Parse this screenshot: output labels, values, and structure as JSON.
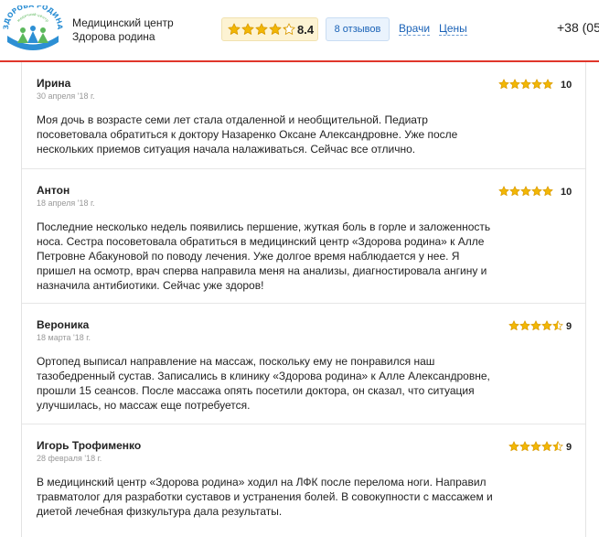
{
  "header": {
    "logo_text": "ЗДОРОВА РОДИНА",
    "logo_subtext": "медичний центр",
    "center_name": "Медицинский центр Здорова родина",
    "rating": {
      "score": "8.4",
      "stars_value": 4.2,
      "stars_max": 5
    },
    "reviews_button": "8 отзывов",
    "nav": {
      "doctors": "Врачи",
      "prices": "Цены"
    },
    "phone": "+38 (05"
  },
  "colors": {
    "accent_red": "#e0362b",
    "star_gold": "#f2b705",
    "link_blue": "#1a62b7",
    "logo_blue": "#2d8fd4",
    "logo_green": "#5cb85c"
  },
  "reviews": [
    {
      "name": "Ирина",
      "date": "30 апреля '18 г.",
      "score": "10",
      "stars_value": 5,
      "text": "Моя дочь в возрасте семи лет стала отдаленной и необщительной. Педиатр посоветовала обратиться к доктору Назаренко Оксане Александровне. Уже после нескольких приемов ситуация начала налаживаться. Сейчас все отлично."
    },
    {
      "name": "Антон",
      "date": "18 апреля '18 г.",
      "score": "10",
      "stars_value": 5,
      "text": "Последние несколько недель появились першение, жуткая боль в горле и заложенность носа. Сестра посоветовала обратиться в медицинский центр «Здорова родина» к Алле Петровне Абакуновой по поводу лечения. Уже долгое время наблюдается у нее. Я пришел на осмотр, врач сперва направила меня на анализы, диагностировала ангину и назначила антибиотики. Сейчас уже здоров!"
    },
    {
      "name": "Вероника",
      "date": "18 марта '18 г.",
      "score": "9",
      "stars_value": 4.5,
      "text": "Ортопед выписал направление на массаж, поскольку ему не понравился наш тазобедренный сустав. Записались в клинику «Здорова родина» к Алле Александровне, прошли 15 сеансов. После массажа опять посетили доктора, он сказал, что ситуация улучшилась, но массаж еще потребуется."
    },
    {
      "name": "Игорь Трофименко",
      "date": "28 февраля '18 г.",
      "score": "9",
      "stars_value": 4.5,
      "text": "В медицинский центр «Здорова родина» ходил на ЛФК после перелома ноги. Направил травматолог для разработки суставов и устранения болей. В совокупности с массажем и диетой лечебная физкультура дала результаты."
    }
  ]
}
